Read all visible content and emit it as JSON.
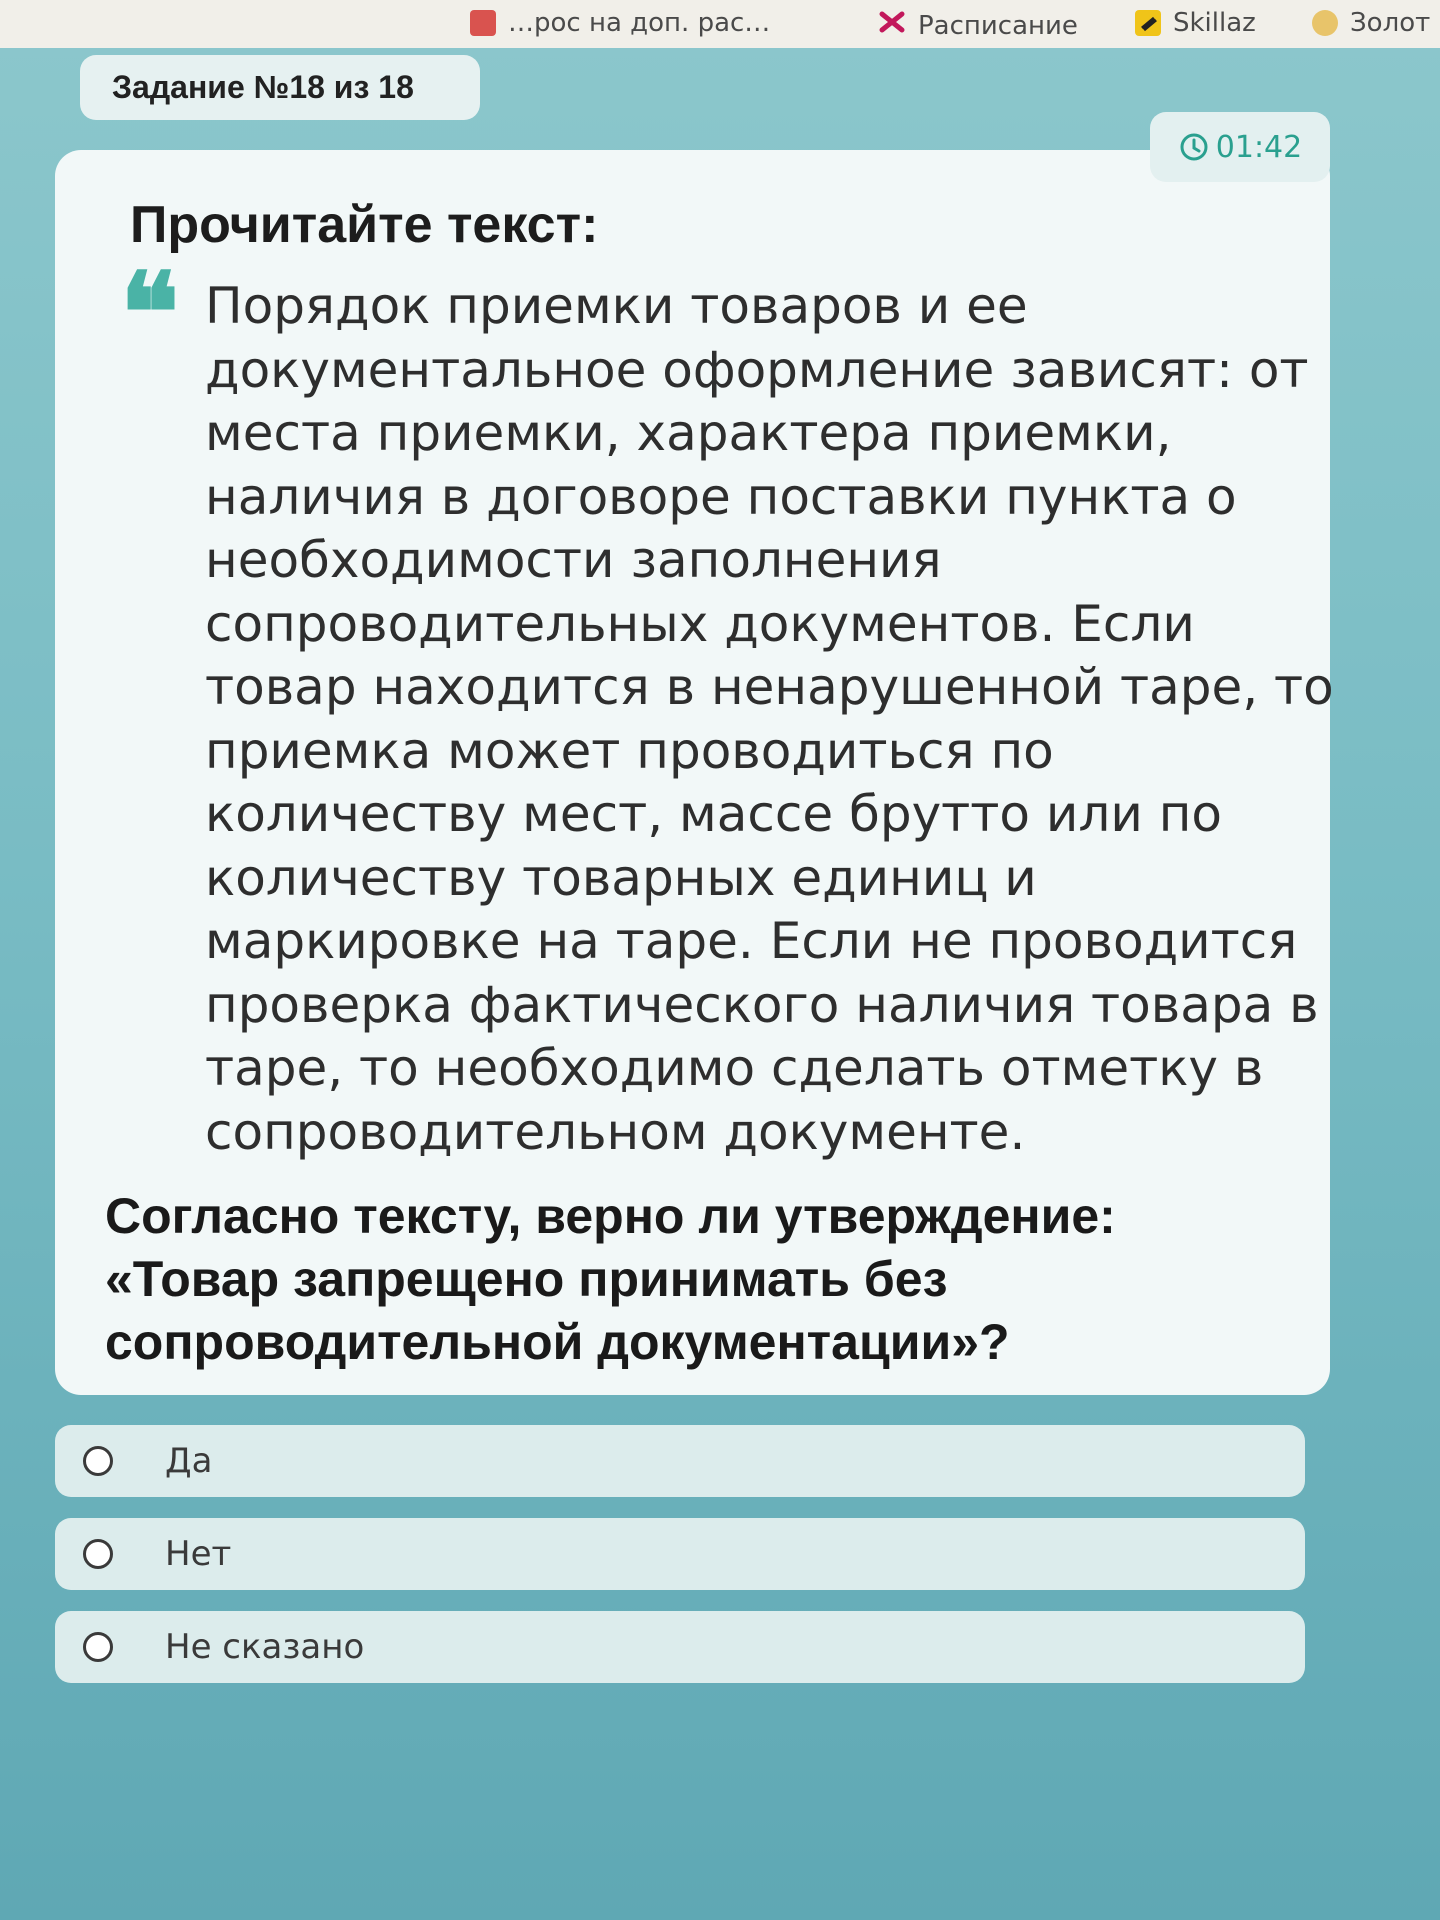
{
  "bookmarks": [
    {
      "label": "…рос на доп. рас…",
      "icon": "bookmark-icon"
    },
    {
      "label": "Расписание",
      "icon": "schedule-icon"
    },
    {
      "label": "Skillaz",
      "icon": "skillaz-icon"
    },
    {
      "label": "Золот",
      "icon": "gold-icon"
    }
  ],
  "task": {
    "label": "Задание №18 из 18"
  },
  "timer": {
    "icon": "clock-icon",
    "value": "01:42"
  },
  "reading": {
    "title": "Прочитайте текст:",
    "quote_icon": "quote-icon",
    "lines": [
      "Порядок приемки товаров и ее",
      "документальное оформление зависят: от",
      "места приемки, характера приемки,",
      "наличия в договоре поставки пункта о",
      "необходимости заполнения",
      "сопроводительных документов. Если",
      "товар находится в ненарушенной таре, то",
      "приемка может проводиться по",
      "количеству мест, массе брутто или по",
      "количеству товарных единиц и",
      "маркировке на таре. Если не проводится",
      "проверка фактического наличия товара в",
      "таре, то необходимо сделать отметку в",
      "сопроводительном документе."
    ]
  },
  "question": {
    "lines": [
      "Согласно тексту, верно ли утверждение:",
      "«Товар запрещено принимать без",
      "сопроводительной документации»?"
    ]
  },
  "options": [
    {
      "label": "Да"
    },
    {
      "label": "Нет"
    },
    {
      "label": "Не сказано"
    }
  ]
}
